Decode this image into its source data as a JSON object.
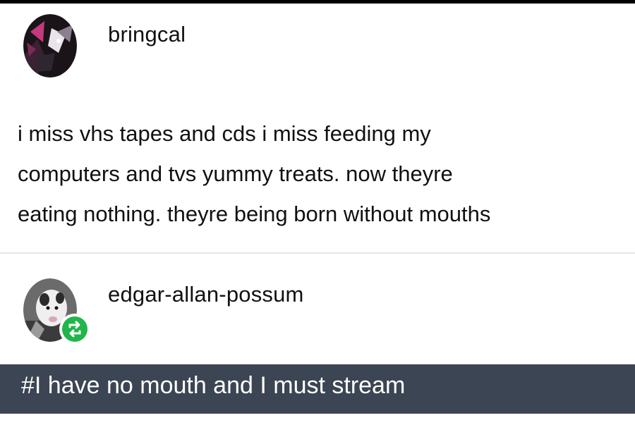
{
  "original_post": {
    "username": "bringcal",
    "avatar_icon": "user-avatar-dark-art",
    "lines": [
      "i miss vhs tapes and cds i miss feeding my",
      "computers and tvs yummy treats. now theyre",
      "eating nothing. theyre being born without mouths"
    ]
  },
  "reblog": {
    "username": "edgar-allan-possum",
    "avatar_icon": "possum-avatar",
    "badge_icon": "reblog-icon",
    "badge_color": "#21b54a",
    "tag": "#I have no mouth and I must stream",
    "tag_bar_color": "#3b4553"
  }
}
